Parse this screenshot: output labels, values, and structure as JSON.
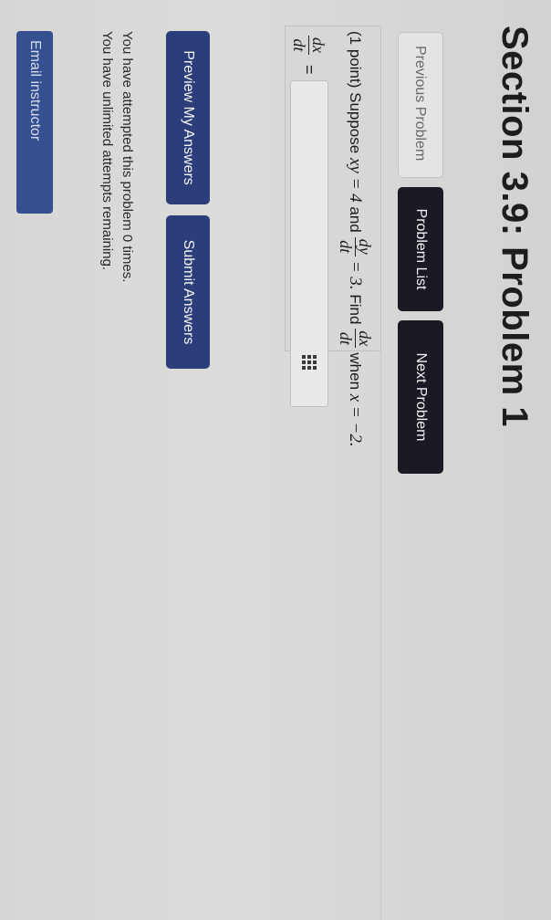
{
  "header": {
    "title": "Section 3.9: Problem 1"
  },
  "nav": {
    "previous_label": "Previous Problem",
    "list_label": "Problem List",
    "next_label": "Next Problem"
  },
  "problem": {
    "points": "(1 point)",
    "suppose": "Suppose",
    "expr1": "xy = 4",
    "and": "and",
    "frac1_num": "dy",
    "frac1_den": "dt",
    "eq1": "= 3.",
    "find": "Find",
    "frac2_num": "dx",
    "frac2_den": "dt",
    "when": "when",
    "cond": "x = −2."
  },
  "answer": {
    "frac_num": "dx",
    "frac_den": "dt",
    "eq": "=",
    "value": "",
    "icon": "grid-icon"
  },
  "actions": {
    "preview_label": "Preview My Answers",
    "submit_label": "Submit Answers"
  },
  "status": {
    "attempted": "You have attempted this problem 0 times.",
    "remaining": "You have unlimited attempts remaining."
  },
  "footer": {
    "email_label": "Email instructor"
  },
  "colors": {
    "dark_button": "#1a1a24",
    "blue_button": "#2c3e7a",
    "email_button": "#355090"
  }
}
